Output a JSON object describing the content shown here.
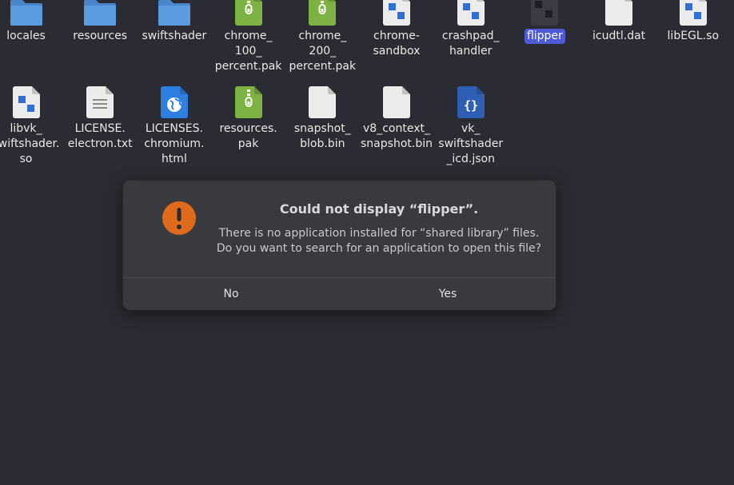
{
  "files_row1": [
    {
      "label": "locales",
      "icon": "folder-icon"
    },
    {
      "label": "resources",
      "icon": "folder-icon"
    },
    {
      "label": "swiftshader",
      "icon": "folder-icon"
    },
    {
      "label": "chrome_\n100_\npercent.pak",
      "icon": "archive-icon"
    },
    {
      "label": "chrome_\n200_\npercent.pak",
      "icon": "archive-icon"
    },
    {
      "label": "chrome-\nsandbox",
      "icon": "executable-icon"
    },
    {
      "label": "crashpad_\nhandler",
      "icon": "executable-icon"
    },
    {
      "label": "flipper",
      "icon": "app-icon"
    },
    {
      "label": "icudtl.dat",
      "icon": "file-icon"
    },
    {
      "label": "libEGL.so",
      "icon": "library-icon"
    }
  ],
  "files_row2": [
    {
      "label": "libvk_\nswiftshader.\nso",
      "icon": "library-icon"
    },
    {
      "label": "LICENSE.\nelectron.txt",
      "icon": "text-file-icon"
    },
    {
      "label": "LICENSES.\nchromium.\nhtml",
      "icon": "web-file-icon"
    },
    {
      "label": "resources.\npak",
      "icon": "archive-icon"
    },
    {
      "label": "snapshot_\nblob.bin",
      "icon": "file-icon"
    },
    {
      "label": "v8_context_\nsnapshot.bin",
      "icon": "file-icon"
    },
    {
      "label": "vk_\nswiftshader\n_icd.json",
      "icon": "json-file-icon"
    }
  ],
  "dialog": {
    "title": "Could not display “flipper”.",
    "message_line1": "There is no application installed for “shared library” files.",
    "message_line2": "Do you want to search for an application to open this file?",
    "no_label": "No",
    "yes_label": "Yes"
  },
  "colors": {
    "background": "#2b2c33",
    "dialog": "#393a40",
    "selection": "#4f5bd5",
    "folder": "#5b9be0",
    "archive": "#7cb342",
    "warning": "#e06a1b",
    "web": "#2f7fe0",
    "json": "#2e5fb5"
  }
}
